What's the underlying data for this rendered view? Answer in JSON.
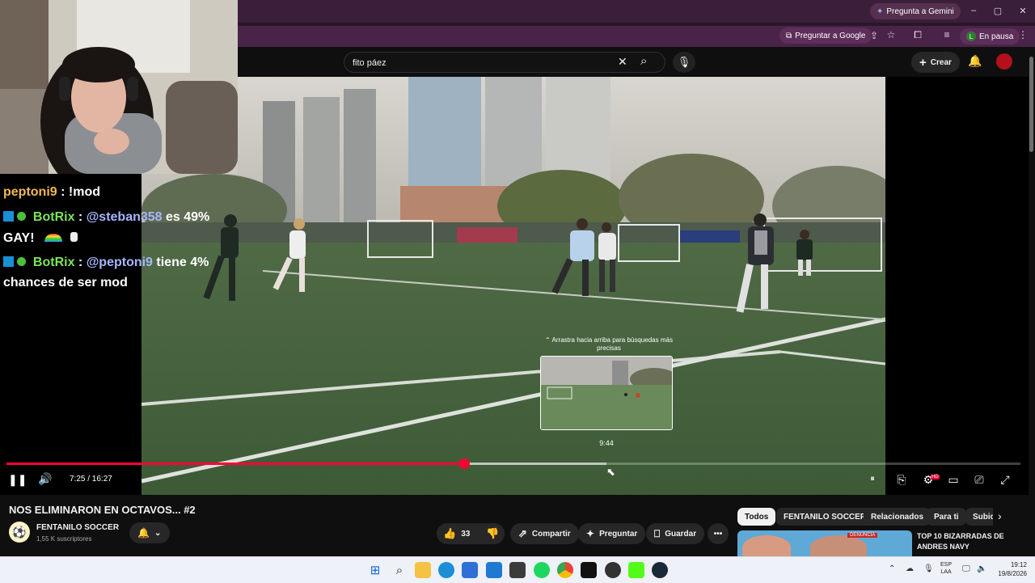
{
  "browser": {
    "gemini_label": "Pregunta a Gemini",
    "google_label": "Preguntar a Google",
    "profile_initial": "L",
    "profile_status": "En pausa",
    "win_controls": [
      "–",
      "▢",
      "✕"
    ]
  },
  "youtube": {
    "search_value": "fito páez",
    "create_label": "Crear"
  },
  "stream_chat": [
    {
      "user": "peptoni9",
      "sep": " : ",
      "text": "!mod",
      "user_color": "#f0b955"
    },
    {
      "user": "BotRix",
      "sep": " : ",
      "mention": "@steban358",
      "text": " es 49%",
      "user_color": "#7ce35a"
    },
    {
      "text": "GAY!"
    },
    {
      "user": "BotRix",
      "sep": " : ",
      "mention": "@peptoni9",
      "text": " tiene 4%",
      "user_color": "#7ce35a"
    },
    {
      "text": "chances de ser mod"
    }
  ],
  "player": {
    "hint": "Arrastra hacia arriba para búsquedas más precisas",
    "preview_time": "9:44",
    "time_display": "7:25 / 16:27",
    "progress_played": 0.451,
    "progress_buffered": 0.592,
    "accent": "#ff0033",
    "hd_badge": "HD"
  },
  "video": {
    "title": "NOS ELIMINARON EN OCTAVOS... #2",
    "channel": "FENTANILO SOCCER",
    "subscribers": "1,55 K suscriptores",
    "likes": "33",
    "share_label": "Compartir",
    "ask_label": "Preguntar",
    "save_label": "Guardar"
  },
  "chips": [
    "Todos",
    "FENTANILO SOCCER",
    "Relacionados",
    "Para ti",
    "Subid"
  ],
  "recommendation": {
    "title": "TOP 10 BIZARRADAS DE ANDRES NAVY",
    "thumb_text": "DENUNCIA"
  },
  "taskbar": {
    "lang": "ESP",
    "lang2": "LAA",
    "time": "19:12",
    "date": "19/8/2026"
  }
}
